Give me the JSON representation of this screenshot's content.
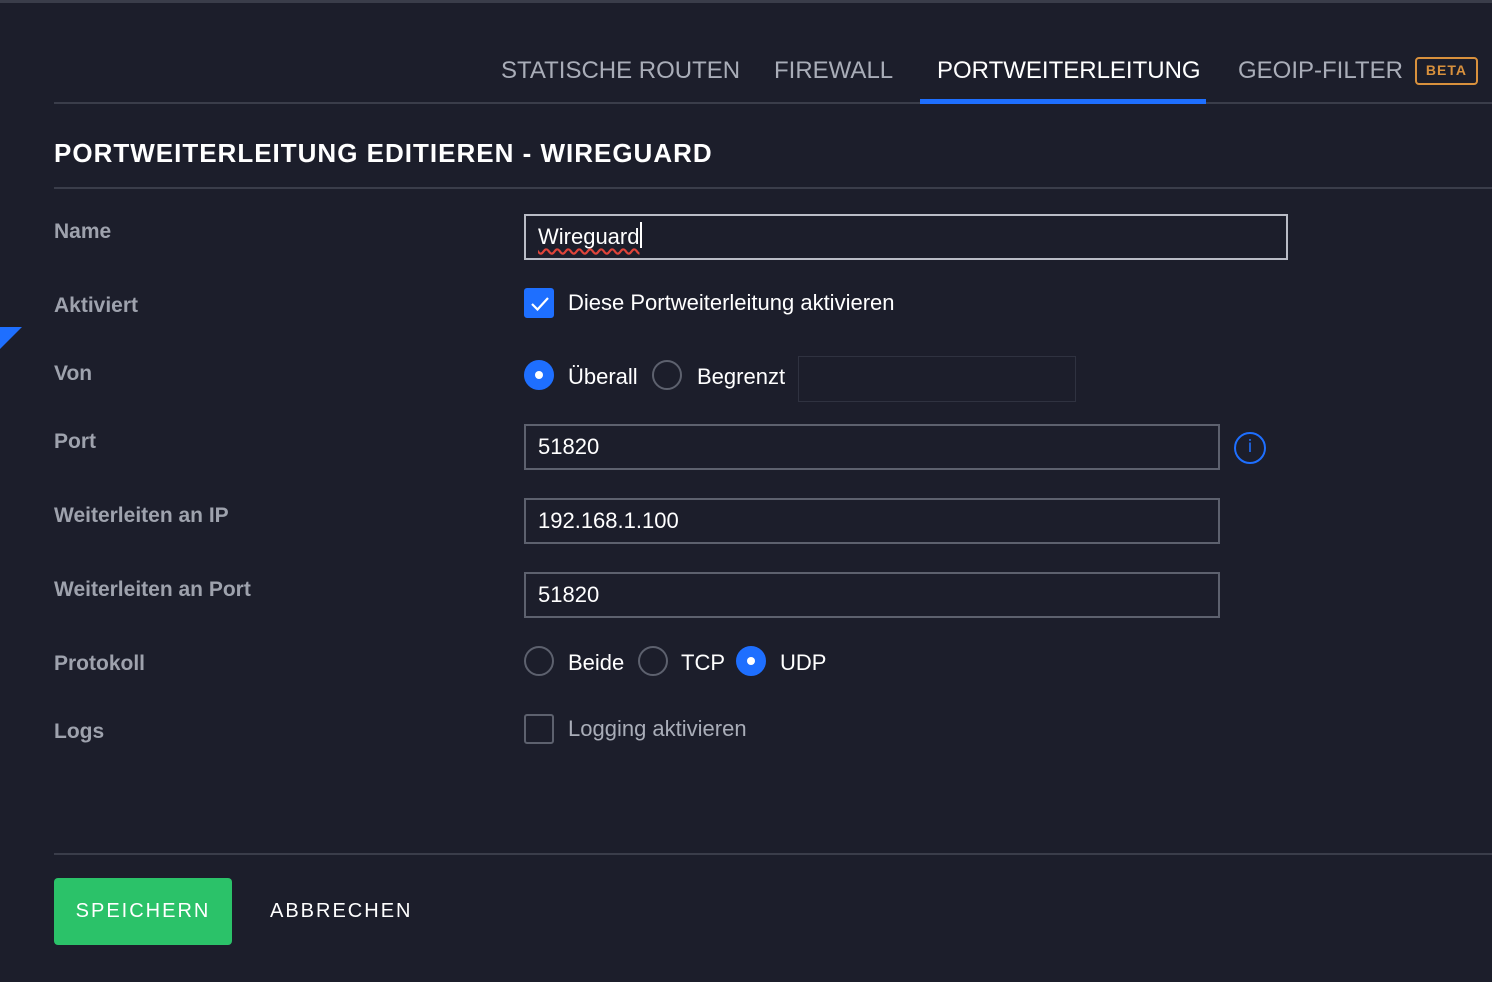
{
  "tabs": [
    {
      "label": "STATISCHE ROUTEN",
      "active": false
    },
    {
      "label": "FIREWALL",
      "active": false
    },
    {
      "label": "PORTWEITERLEITUNG",
      "active": true
    },
    {
      "label": "GEOIP-FILTER",
      "active": false,
      "badge": "BETA"
    }
  ],
  "page_title": "PORTWEITERLEITUNG EDITIEREN - WIREGUARD",
  "form": {
    "name": {
      "label": "Name",
      "value": "Wireguard"
    },
    "enabled": {
      "label": "Aktiviert",
      "checkbox_label": "Diese Portweiterleitung aktivieren",
      "checked": true
    },
    "from": {
      "label": "Von",
      "options": [
        "Überall",
        "Begrenzt"
      ],
      "selected": "Überall",
      "restricted_value": ""
    },
    "port": {
      "label": "Port",
      "value": "51820",
      "info_icon": "info-icon"
    },
    "forward_ip": {
      "label": "Weiterleiten an IP",
      "value": "192.168.1.100"
    },
    "forward_port": {
      "label": "Weiterleiten an Port",
      "value": "51820"
    },
    "protocol": {
      "label": "Protokoll",
      "options": [
        "Beide",
        "TCP",
        "UDP"
      ],
      "selected": "UDP"
    },
    "logs": {
      "label": "Logs",
      "checkbox_label": "Logging aktivieren",
      "checked": false
    }
  },
  "buttons": {
    "save": "SPEICHERN",
    "cancel": "ABBRECHEN"
  },
  "colors": {
    "background": "#1c1e2b",
    "accent": "#1e6fff",
    "save_button": "#2bc269",
    "beta_badge": "#d9913d"
  }
}
